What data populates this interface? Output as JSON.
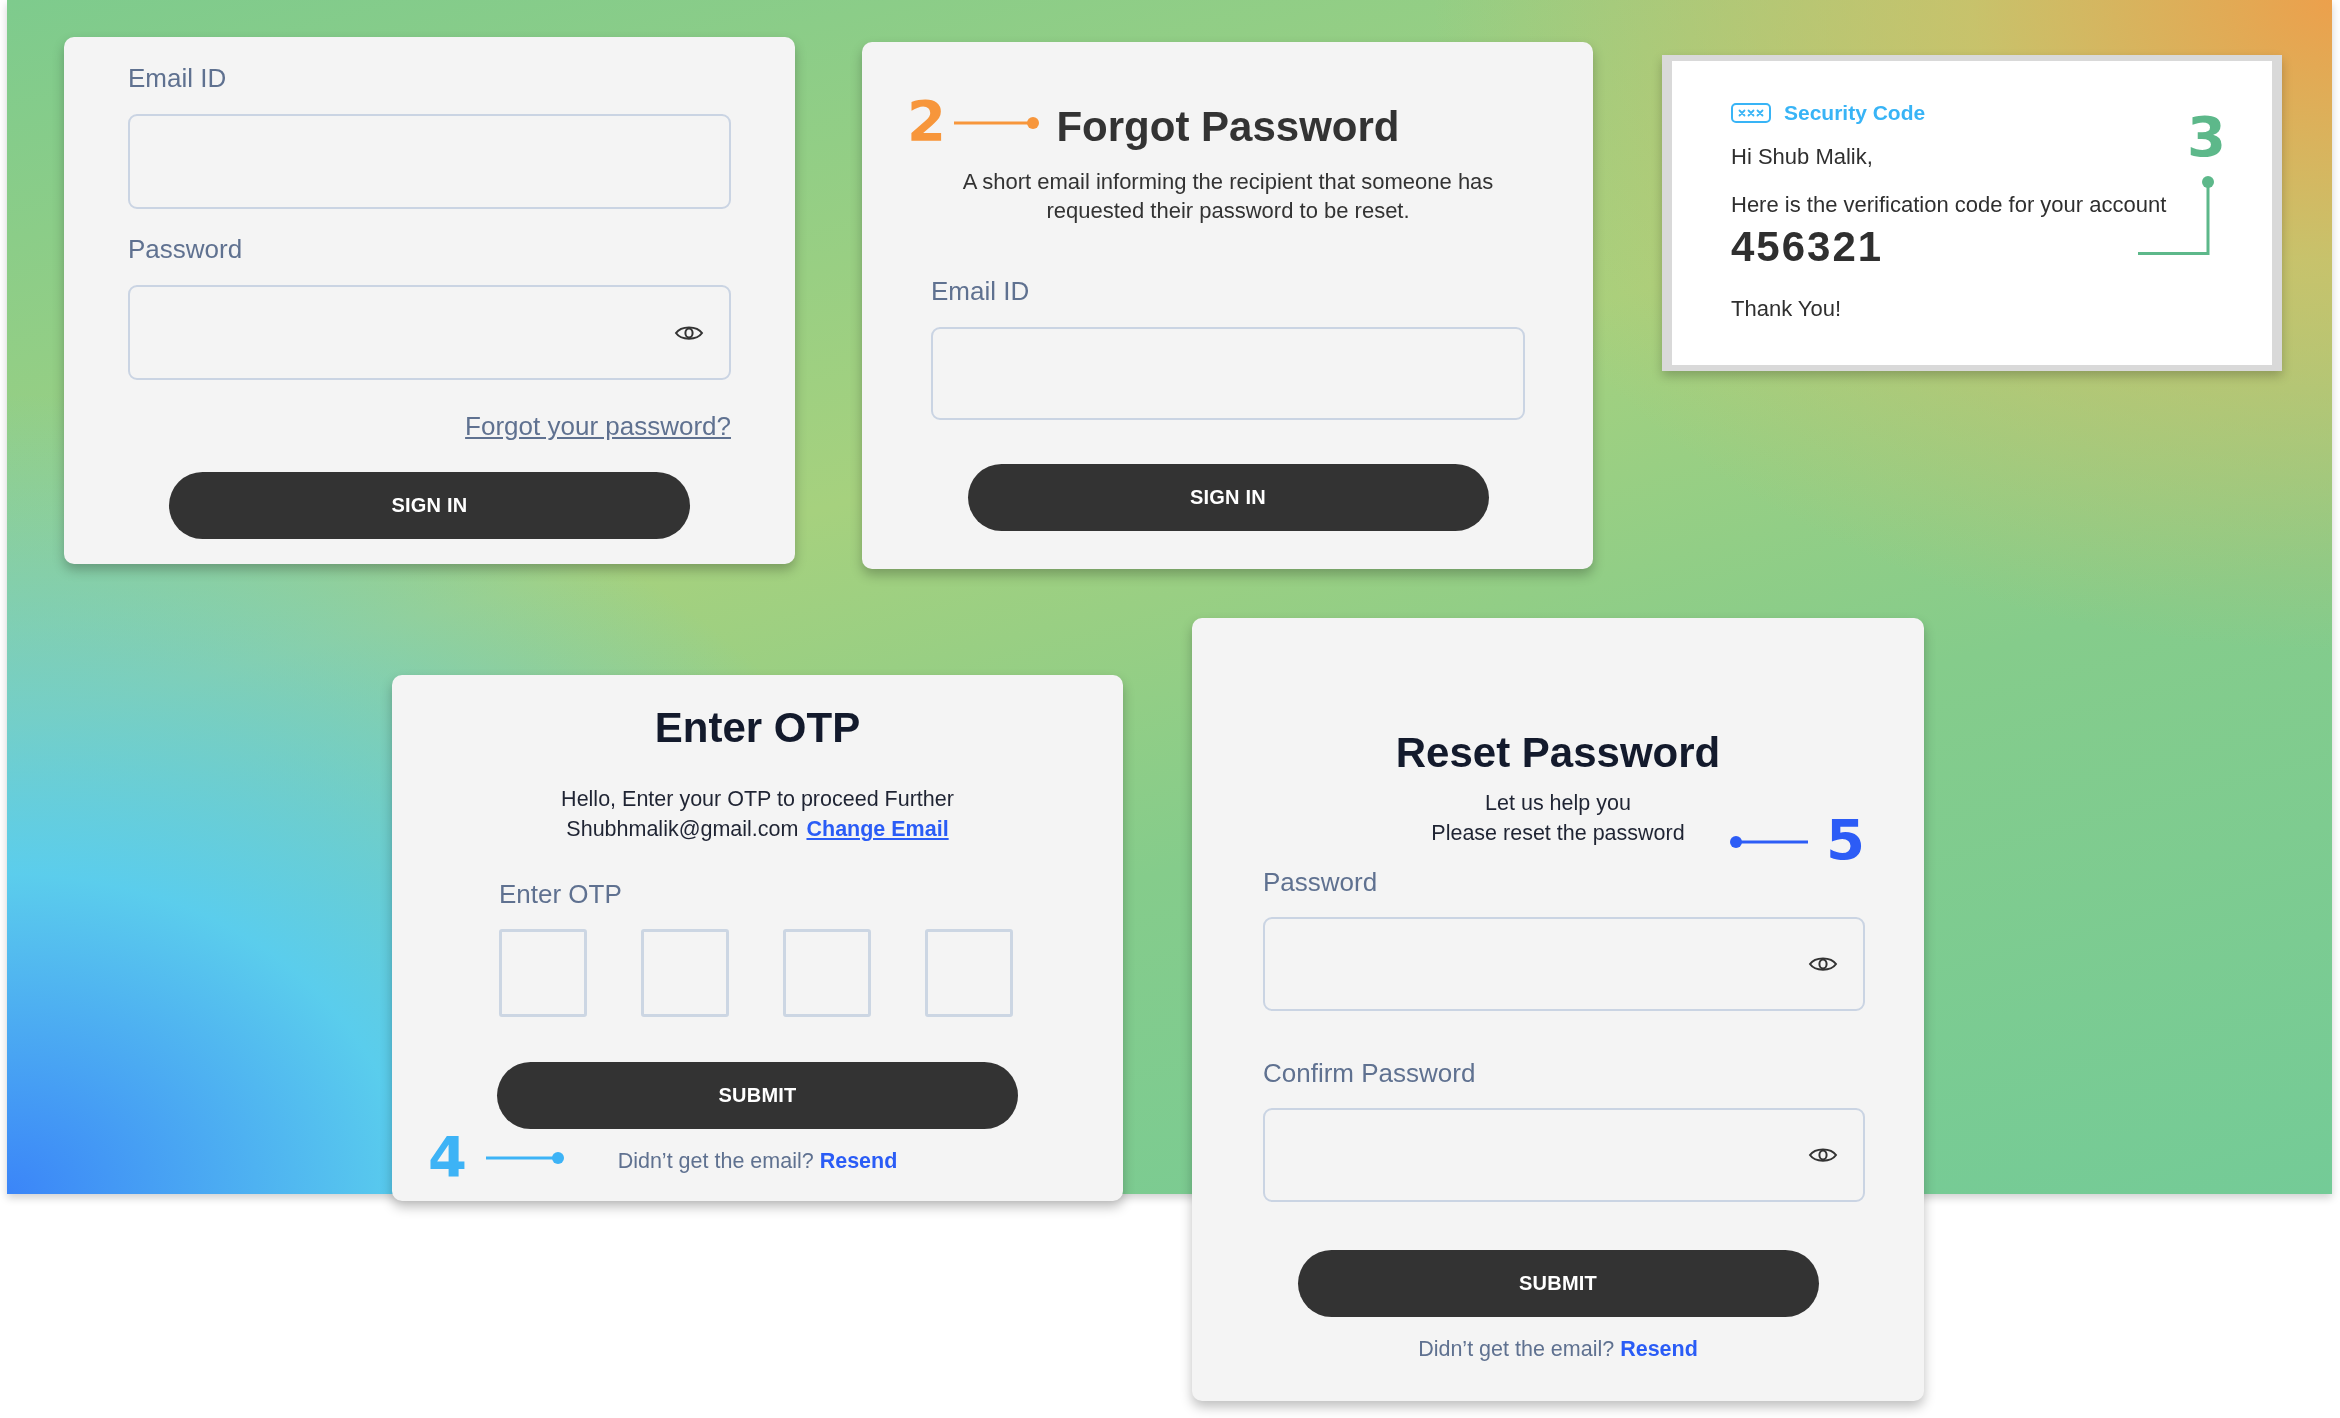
{
  "cards": [
    {
      "kind": "login",
      "fields": [
        {
          "label": "Email ID",
          "kind": "text"
        },
        {
          "label": "Password",
          "kind": "password"
        }
      ],
      "link": "Forgot your password?",
      "button": "SIGN IN"
    },
    {
      "kind": "forgot",
      "marker": {
        "label": "2",
        "color": "#f7963b"
      },
      "title": "Forgot Password",
      "description": "A short email informing the recipient that someone has requested their password to be reset.",
      "fields": [
        {
          "label": "Email ID",
          "kind": "text"
        }
      ],
      "button": "SIGN IN"
    },
    {
      "kind": "email",
      "marker": {
        "label": "3",
        "color": "#5db88a"
      },
      "heading": "Security Code",
      "greeting": "Hi Shub Malik,",
      "message": "Here is the verification code for your account",
      "code": "456321",
      "closing": "Thank You!"
    },
    {
      "kind": "otp",
      "marker": {
        "label": "4",
        "color": "#3db3f6"
      },
      "title": "Enter OTP",
      "message": "Hello, Enter your OTP to proceed Further",
      "email": "Shubhmalik@gmail.com",
      "email_link": "Change Email",
      "otp_label": "Enter OTP",
      "otp_fields": [
        {
          "focused": false
        },
        {
          "focused": false
        },
        {
          "focused": false
        },
        {
          "focused": false
        }
      ],
      "button": "SUBMIT",
      "footer": {
        "text": "Didn’t get the email?",
        "link": "Resend"
      }
    },
    {
      "kind": "reset",
      "marker": {
        "label": "5",
        "color": "#2c5cf6"
      },
      "title": "Reset Password",
      "description": [
        "Let us help you",
        "Please reset the password"
      ],
      "fields": [
        {
          "label": "Password",
          "kind": "password"
        },
        {
          "label": "Confirm Password",
          "kind": "password"
        }
      ],
      "button": "SUBMIT",
      "footer": {
        "text": "Didn’t get the email?",
        "link": "Resend"
      }
    }
  ]
}
